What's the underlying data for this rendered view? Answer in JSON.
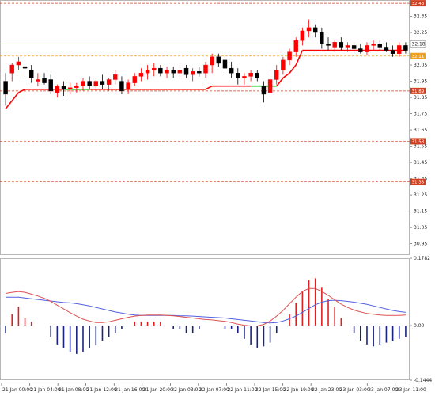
{
  "chart_data": [
    {
      "type": "candlestick",
      "ylim": [
        30.88,
        32.45
      ],
      "y_ticks": [
        "32.35",
        "32.25",
        "32.05",
        "31.95",
        "31.85",
        "31.75",
        "31.65",
        "31.55",
        "31.45",
        "31.35",
        "31.25",
        "31.15",
        "31.05",
        "30.95"
      ],
      "y_tick_values": [
        32.35,
        32.25,
        32.05,
        31.95,
        31.85,
        31.75,
        31.65,
        31.55,
        31.45,
        31.35,
        31.25,
        31.15,
        31.05,
        30.95
      ],
      "current_price_label": "32.18",
      "level_lines": [
        {
          "label": "32.43",
          "value": 32.43,
          "color": "#d04020"
        },
        {
          "label": "32.11",
          "value": 32.105,
          "color": "#f0a020"
        },
        {
          "label": "31.89",
          "value": 31.89,
          "color": "#d04020"
        },
        {
          "label": "31.58",
          "value": 31.58,
          "color": "#d04020"
        },
        {
          "label": "31.33",
          "value": 31.33,
          "color": "#d04020"
        }
      ],
      "colors": {
        "bull": "#ff0000",
        "bear": "#000000",
        "stop_red": "#ff0000",
        "stop_green": "#00c000",
        "level": "#d04020",
        "level_orange": "#f0a020",
        "price_line": "#7fb060"
      },
      "candles": [
        {
          "o": 31.95,
          "h": 32.0,
          "l": 31.8,
          "c": 31.87
        },
        {
          "o": 32.0,
          "h": 32.06,
          "l": 31.95,
          "c": 32.05
        },
        {
          "o": 32.05,
          "h": 32.1,
          "l": 32.02,
          "c": 32.07
        },
        {
          "o": 32.04,
          "h": 32.08,
          "l": 31.98,
          "c": 32.03
        },
        {
          "o": 32.02,
          "h": 32.05,
          "l": 31.94,
          "c": 31.97
        },
        {
          "o": 31.95,
          "h": 32.0,
          "l": 31.92,
          "c": 31.96
        },
        {
          "o": 31.97,
          "h": 32.0,
          "l": 31.93,
          "c": 31.94
        },
        {
          "o": 31.96,
          "h": 31.99,
          "l": 31.87,
          "c": 31.89
        },
        {
          "o": 31.88,
          "h": 31.93,
          "l": 31.85,
          "c": 31.92
        },
        {
          "o": 31.92,
          "h": 31.95,
          "l": 31.86,
          "c": 31.9
        },
        {
          "o": 31.9,
          "h": 31.94,
          "l": 31.87,
          "c": 31.91
        },
        {
          "o": 31.91,
          "h": 31.94,
          "l": 31.88,
          "c": 31.92
        },
        {
          "o": 31.92,
          "h": 31.97,
          "l": 31.89,
          "c": 31.95
        },
        {
          "o": 31.95,
          "h": 31.98,
          "l": 31.9,
          "c": 31.92
        },
        {
          "o": 31.92,
          "h": 31.97,
          "l": 31.89,
          "c": 31.95
        },
        {
          "o": 31.95,
          "h": 31.99,
          "l": 31.9,
          "c": 31.93
        },
        {
          "o": 31.93,
          "h": 31.97,
          "l": 31.89,
          "c": 31.96
        },
        {
          "o": 31.96,
          "h": 32.02,
          "l": 31.93,
          "c": 31.99
        },
        {
          "o": 31.95,
          "h": 31.98,
          "l": 31.87,
          "c": 31.89
        },
        {
          "o": 31.9,
          "h": 31.96,
          "l": 31.87,
          "c": 31.94
        },
        {
          "o": 31.94,
          "h": 32.0,
          "l": 31.92,
          "c": 31.98
        },
        {
          "o": 31.98,
          "h": 32.03,
          "l": 31.95,
          "c": 32.0
        },
        {
          "o": 32.0,
          "h": 32.05,
          "l": 31.96,
          "c": 32.02
        },
        {
          "o": 32.02,
          "h": 32.06,
          "l": 31.98,
          "c": 32.03
        },
        {
          "o": 32.03,
          "h": 32.05,
          "l": 31.98,
          "c": 32.0
        },
        {
          "o": 32.0,
          "h": 32.04,
          "l": 31.97,
          "c": 32.02
        },
        {
          "o": 32.02,
          "h": 32.04,
          "l": 31.97,
          "c": 32.0
        },
        {
          "o": 32.0,
          "h": 32.05,
          "l": 31.96,
          "c": 32.02
        },
        {
          "o": 32.03,
          "h": 32.05,
          "l": 31.97,
          "c": 31.99
        },
        {
          "o": 31.99,
          "h": 32.03,
          "l": 31.95,
          "c": 32.01
        },
        {
          "o": 32.01,
          "h": 32.04,
          "l": 31.98,
          "c": 32.0
        },
        {
          "o": 32.0,
          "h": 32.07,
          "l": 31.97,
          "c": 32.05
        },
        {
          "o": 32.05,
          "h": 32.12,
          "l": 32.0,
          "c": 32.1
        },
        {
          "o": 32.1,
          "h": 32.12,
          "l": 32.04,
          "c": 32.06
        },
        {
          "o": 32.08,
          "h": 32.1,
          "l": 32.0,
          "c": 32.03
        },
        {
          "o": 32.03,
          "h": 32.07,
          "l": 31.97,
          "c": 32.0
        },
        {
          "o": 32.0,
          "h": 32.03,
          "l": 31.93,
          "c": 31.97
        },
        {
          "o": 31.97,
          "h": 32.0,
          "l": 31.93,
          "c": 31.98
        },
        {
          "o": 31.98,
          "h": 32.02,
          "l": 31.95,
          "c": 32.0
        },
        {
          "o": 32.0,
          "h": 32.02,
          "l": 31.95,
          "c": 31.97
        },
        {
          "o": 31.92,
          "h": 31.95,
          "l": 31.82,
          "c": 31.87
        },
        {
          "o": 31.88,
          "h": 32.0,
          "l": 31.84,
          "c": 31.96
        },
        {
          "o": 31.96,
          "h": 32.05,
          "l": 31.93,
          "c": 32.02
        },
        {
          "o": 32.02,
          "h": 32.1,
          "l": 31.99,
          "c": 32.08
        },
        {
          "o": 32.08,
          "h": 32.15,
          "l": 32.05,
          "c": 32.13
        },
        {
          "o": 32.13,
          "h": 32.22,
          "l": 32.1,
          "c": 32.2
        },
        {
          "o": 32.2,
          "h": 32.28,
          "l": 32.17,
          "c": 32.26
        },
        {
          "o": 32.26,
          "h": 32.33,
          "l": 32.22,
          "c": 32.28
        },
        {
          "o": 32.28,
          "h": 32.3,
          "l": 32.22,
          "c": 32.25
        },
        {
          "o": 32.25,
          "h": 32.28,
          "l": 32.15,
          "c": 32.18
        },
        {
          "o": 32.18,
          "h": 32.22,
          "l": 32.14,
          "c": 32.17
        },
        {
          "o": 32.16,
          "h": 32.2,
          "l": 32.13,
          "c": 32.19
        },
        {
          "o": 32.19,
          "h": 32.22,
          "l": 32.14,
          "c": 32.16
        },
        {
          "o": 32.16,
          "h": 32.19,
          "l": 32.13,
          "c": 32.17
        },
        {
          "o": 32.17,
          "h": 32.19,
          "l": 32.12,
          "c": 32.15
        },
        {
          "o": 32.15,
          "h": 32.18,
          "l": 32.12,
          "c": 32.13
        },
        {
          "o": 32.13,
          "h": 32.19,
          "l": 32.11,
          "c": 32.17
        },
        {
          "o": 32.17,
          "h": 32.2,
          "l": 32.14,
          "c": 32.18
        },
        {
          "o": 32.18,
          "h": 32.2,
          "l": 32.14,
          "c": 32.16
        },
        {
          "o": 32.16,
          "h": 32.19,
          "l": 32.13,
          "c": 32.14
        },
        {
          "o": 32.14,
          "h": 32.17,
          "l": 32.1,
          "c": 32.12
        },
        {
          "o": 32.12,
          "h": 32.19,
          "l": 32.1,
          "c": 32.17
        },
        {
          "o": 32.17,
          "h": 32.19,
          "l": 32.12,
          "c": 32.14
        }
      ],
      "trailing_stop": [
        {
          "v": 31.78,
          "c": "red"
        },
        {
          "v": 31.83,
          "c": "red"
        },
        {
          "v": 31.88,
          "c": "red"
        },
        {
          "v": 31.9,
          "c": "red"
        },
        {
          "v": 31.9,
          "c": "red"
        },
        {
          "v": 31.9,
          "c": "red"
        },
        {
          "v": 31.9,
          "c": "red"
        },
        {
          "v": 31.9,
          "c": "red"
        },
        {
          "v": 31.9,
          "c": "red"
        },
        {
          "v": 31.9,
          "c": "green"
        },
        {
          "v": 31.9,
          "c": "green"
        },
        {
          "v": 31.9,
          "c": "green"
        },
        {
          "v": 31.9,
          "c": "green"
        },
        {
          "v": 31.9,
          "c": "red"
        },
        {
          "v": 31.9,
          "c": "red"
        },
        {
          "v": 31.9,
          "c": "red"
        },
        {
          "v": 31.9,
          "c": "red"
        },
        {
          "v": 31.9,
          "c": "red"
        },
        {
          "v": 31.9,
          "c": "red"
        },
        {
          "v": 31.9,
          "c": "red"
        },
        {
          "v": 31.9,
          "c": "red"
        },
        {
          "v": 31.9,
          "c": "red"
        },
        {
          "v": 31.9,
          "c": "red"
        },
        {
          "v": 31.9,
          "c": "red"
        },
        {
          "v": 31.9,
          "c": "red"
        },
        {
          "v": 31.9,
          "c": "red"
        },
        {
          "v": 31.9,
          "c": "red"
        },
        {
          "v": 31.9,
          "c": "red"
        },
        {
          "v": 31.9,
          "c": "red"
        },
        {
          "v": 31.9,
          "c": "red"
        },
        {
          "v": 31.9,
          "c": "red"
        },
        {
          "v": 31.9,
          "c": "red"
        },
        {
          "v": 31.92,
          "c": "red"
        },
        {
          "v": 31.92,
          "c": "red"
        },
        {
          "v": 31.92,
          "c": "red"
        },
        {
          "v": 31.92,
          "c": "red"
        },
        {
          "v": 31.92,
          "c": "red"
        },
        {
          "v": 31.92,
          "c": "red"
        },
        {
          "v": 31.92,
          "c": "green"
        },
        {
          "v": 31.92,
          "c": "green"
        },
        {
          "v": 31.92,
          "c": "green"
        },
        {
          "v": 31.92,
          "c": "green"
        },
        {
          "v": 31.92,
          "c": "red"
        },
        {
          "v": 31.97,
          "c": "red"
        },
        {
          "v": 32.0,
          "c": "red"
        },
        {
          "v": 32.05,
          "c": "red"
        },
        {
          "v": 32.14,
          "c": "red"
        },
        {
          "v": 32.14,
          "c": "red"
        },
        {
          "v": 32.14,
          "c": "red"
        },
        {
          "v": 32.14,
          "c": "red"
        },
        {
          "v": 32.14,
          "c": "red"
        },
        {
          "v": 32.14,
          "c": "red"
        },
        {
          "v": 32.14,
          "c": "red"
        },
        {
          "v": 32.14,
          "c": "red"
        },
        {
          "v": 32.14,
          "c": "red"
        },
        {
          "v": 32.14,
          "c": "red"
        },
        {
          "v": 32.14,
          "c": "red"
        },
        {
          "v": 32.14,
          "c": "red"
        },
        {
          "v": 32.14,
          "c": "red"
        },
        {
          "v": 32.14,
          "c": "red"
        },
        {
          "v": 32.14,
          "c": "red"
        },
        {
          "v": 32.14,
          "c": "red"
        },
        {
          "v": 32.14,
          "c": "red"
        }
      ]
    },
    {
      "type": "histogram",
      "ylim": [
        -0.1444,
        0.1782
      ],
      "y_ticks": [
        "0.1782",
        "0.00",
        "-0.1444"
      ],
      "y_tick_values": [
        0.1782,
        0.0,
        -0.1444
      ],
      "colors": {
        "pos": "#e02020",
        "neg": "#1a237e",
        "line_blue": "#5060e0",
        "line_red": "#e05050"
      },
      "bars": [
        -0.02,
        0.03,
        0.05,
        0.02,
        0.01,
        0.0,
        0.0,
        -0.03,
        -0.05,
        -0.06,
        -0.07,
        -0.075,
        -0.07,
        -0.06,
        -0.05,
        -0.04,
        -0.03,
        -0.02,
        -0.01,
        0.0,
        0.01,
        0.01,
        0.01,
        0.01,
        0.01,
        0.0,
        -0.01,
        -0.01,
        -0.02,
        -0.02,
        -0.01,
        0.0,
        0.0,
        0.0,
        -0.01,
        -0.01,
        -0.02,
        -0.035,
        -0.05,
        -0.06,
        -0.055,
        -0.045,
        -0.02,
        0.0,
        0.03,
        0.06,
        0.09,
        0.12,
        0.125,
        0.1,
        0.07,
        0.05,
        0.02,
        0.0,
        -0.02,
        -0.04,
        -0.05,
        -0.055,
        -0.05,
        -0.045,
        -0.04,
        -0.035,
        -0.03
      ],
      "line_blue": [
        0.075,
        0.075,
        0.075,
        0.073,
        0.071,
        0.069,
        0.067,
        0.065,
        0.063,
        0.061,
        0.06,
        0.058,
        0.055,
        0.052,
        0.048,
        0.044,
        0.04,
        0.036,
        0.033,
        0.03,
        0.028,
        0.027,
        0.027,
        0.027,
        0.027,
        0.027,
        0.027,
        0.026,
        0.026,
        0.025,
        0.024,
        0.023,
        0.022,
        0.021,
        0.02,
        0.018,
        0.016,
        0.014,
        0.012,
        0.01,
        0.008,
        0.007,
        0.008,
        0.012,
        0.018,
        0.025,
        0.035,
        0.045,
        0.055,
        0.062,
        0.066,
        0.067,
        0.066,
        0.064,
        0.062,
        0.059,
        0.056,
        0.052,
        0.048,
        0.044,
        0.04,
        0.037,
        0.035
      ],
      "line_red": [
        0.085,
        0.088,
        0.09,
        0.088,
        0.083,
        0.078,
        0.072,
        0.064,
        0.054,
        0.044,
        0.034,
        0.025,
        0.017,
        0.012,
        0.008,
        0.008,
        0.01,
        0.014,
        0.018,
        0.022,
        0.025,
        0.027,
        0.028,
        0.028,
        0.028,
        0.027,
        0.026,
        0.024,
        0.022,
        0.02,
        0.018,
        0.016,
        0.015,
        0.013,
        0.011,
        0.008,
        0.004,
        0.001,
        -0.001,
        -0.001,
        0.003,
        0.012,
        0.025,
        0.04,
        0.058,
        0.075,
        0.09,
        0.098,
        0.098,
        0.09,
        0.08,
        0.068,
        0.057,
        0.048,
        0.041,
        0.036,
        0.032,
        0.03,
        0.028,
        0.027,
        0.027,
        0.027,
        0.028
      ]
    }
  ],
  "x_axis": {
    "labels": [
      "21 Jan 00:00",
      "21 Jan 04:00",
      "21 Jan 08:00",
      "21 Jan 12:00",
      "21 Jan 16:00",
      "21 Jan 20:00",
      "22 Jan 03:00",
      "22 Jan 07:00",
      "22 Jan 11:00",
      "22 Jan 15:00",
      "22 Jan 19:00",
      "22 Jan 23:00",
      "23 Jan 03:00",
      "23 Jan 07:00",
      "23 Jan 11:00"
    ]
  }
}
